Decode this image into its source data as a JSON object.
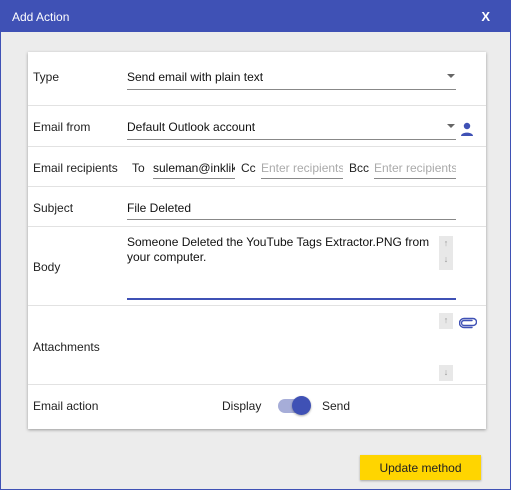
{
  "dialog": {
    "title": "Add Action",
    "close_label": "X"
  },
  "type": {
    "label": "Type",
    "value": "Send email with plain text"
  },
  "email_from": {
    "label": "Email from",
    "value": "Default Outlook account"
  },
  "recipients": {
    "label": "Email recipients",
    "to_label": "To",
    "to_value": "suleman@inklik",
    "cc_label": "Cc",
    "cc_placeholder": "Enter recipients",
    "bcc_label": "Bcc",
    "bcc_placeholder": "Enter recipients"
  },
  "subject": {
    "label": "Subject",
    "value": "File Deleted"
  },
  "body": {
    "label": "Body",
    "value": "Someone Deleted the YouTube Tags Extractor.PNG from your computer."
  },
  "attachments": {
    "label": "Attachments"
  },
  "email_action": {
    "label": "Email action",
    "option_left": "Display",
    "option_right": "Send",
    "selected": "Send"
  },
  "footer": {
    "update_label": "Update method"
  },
  "colors": {
    "accent": "#3f51b5",
    "button": "#ffd500"
  }
}
